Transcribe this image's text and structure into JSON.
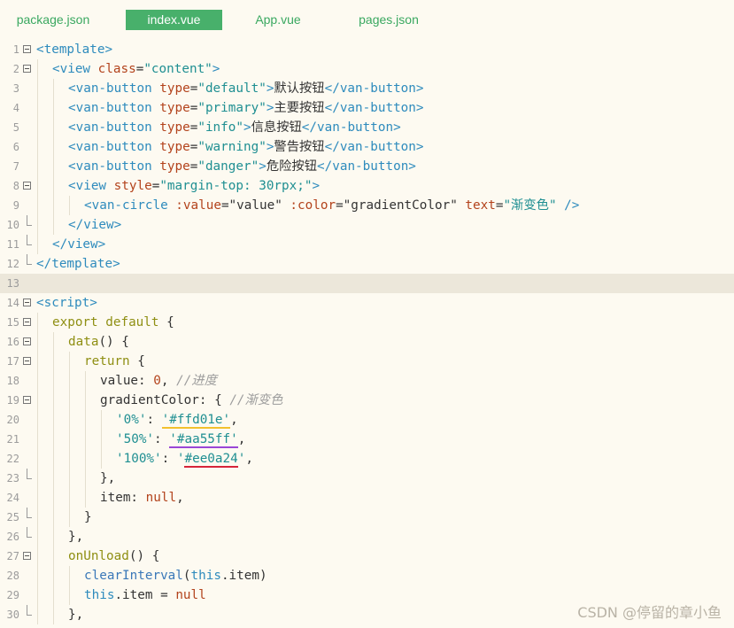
{
  "tabs": [
    {
      "label": "package.json",
      "active": false
    },
    {
      "label": "index.vue",
      "active": true
    },
    {
      "label": "App.vue",
      "active": false
    },
    {
      "label": "pages.json",
      "active": false
    }
  ],
  "lines": [
    {
      "n": "1",
      "fold": "open",
      "indent": 0,
      "tokens": [
        [
          "t-tag",
          "<template>"
        ]
      ]
    },
    {
      "n": "2",
      "fold": "open",
      "indent": 1,
      "tokens": [
        [
          "t-tag",
          "<view "
        ],
        [
          "t-attr",
          "class"
        ],
        [
          "t-txt",
          "="
        ],
        [
          "t-str",
          "\"content\""
        ],
        [
          "t-tag",
          ">"
        ]
      ]
    },
    {
      "n": "3",
      "fold": "",
      "indent": 2,
      "tokens": [
        [
          "t-tag",
          "<van-button "
        ],
        [
          "t-attr",
          "type"
        ],
        [
          "t-txt",
          "="
        ],
        [
          "t-str",
          "\"default\""
        ],
        [
          "t-tag",
          ">"
        ],
        [
          "t-txt",
          "默认按钮"
        ],
        [
          "t-tag",
          "</van-button>"
        ]
      ]
    },
    {
      "n": "4",
      "fold": "",
      "indent": 2,
      "tokens": [
        [
          "t-tag",
          "<van-button "
        ],
        [
          "t-attr",
          "type"
        ],
        [
          "t-txt",
          "="
        ],
        [
          "t-str",
          "\"primary\""
        ],
        [
          "t-tag",
          ">"
        ],
        [
          "t-txt",
          "主要按钮"
        ],
        [
          "t-tag",
          "</van-button>"
        ]
      ]
    },
    {
      "n": "5",
      "fold": "",
      "indent": 2,
      "tokens": [
        [
          "t-tag",
          "<van-button "
        ],
        [
          "t-attr",
          "type"
        ],
        [
          "t-txt",
          "="
        ],
        [
          "t-str",
          "\"info\""
        ],
        [
          "t-tag",
          ">"
        ],
        [
          "t-txt",
          "信息按钮"
        ],
        [
          "t-tag",
          "</van-button>"
        ]
      ]
    },
    {
      "n": "6",
      "fold": "",
      "indent": 2,
      "tokens": [
        [
          "t-tag",
          "<van-button "
        ],
        [
          "t-attr",
          "type"
        ],
        [
          "t-txt",
          "="
        ],
        [
          "t-str",
          "\"warning\""
        ],
        [
          "t-tag",
          ">"
        ],
        [
          "t-txt",
          "警告按钮"
        ],
        [
          "t-tag",
          "</van-button>"
        ]
      ]
    },
    {
      "n": "7",
      "fold": "",
      "indent": 2,
      "tokens": [
        [
          "t-tag",
          "<van-button "
        ],
        [
          "t-attr",
          "type"
        ],
        [
          "t-txt",
          "="
        ],
        [
          "t-str",
          "\"danger\""
        ],
        [
          "t-tag",
          ">"
        ],
        [
          "t-txt",
          "危险按钮"
        ],
        [
          "t-tag",
          "</van-button>"
        ]
      ]
    },
    {
      "n": "8",
      "fold": "open",
      "indent": 2,
      "tokens": [
        [
          "t-tag",
          "<view "
        ],
        [
          "t-attr",
          "style"
        ],
        [
          "t-txt",
          "="
        ],
        [
          "t-str",
          "\"margin-top: 30rpx;\""
        ],
        [
          "t-tag",
          ">"
        ]
      ]
    },
    {
      "n": "9",
      "fold": "",
      "indent": 3,
      "tokens": [
        [
          "t-tag",
          "<van-circle "
        ],
        [
          "t-attr",
          ":value"
        ],
        [
          "t-txt",
          "=\"value\" "
        ],
        [
          "t-attr",
          ":color"
        ],
        [
          "t-txt",
          "=\"gradientColor\" "
        ],
        [
          "t-attr",
          "text"
        ],
        [
          "t-txt",
          "="
        ],
        [
          "t-str",
          "\"渐变色\""
        ],
        [
          "t-tag",
          " />"
        ]
      ]
    },
    {
      "n": "10",
      "fold": "end",
      "indent": 2,
      "tokens": [
        [
          "t-tag",
          "</view>"
        ]
      ]
    },
    {
      "n": "11",
      "fold": "end",
      "indent": 1,
      "tokens": [
        [
          "t-tag",
          "</view>"
        ]
      ]
    },
    {
      "n": "12",
      "fold": "end",
      "indent": 0,
      "tokens": [
        [
          "t-tag",
          "</template>"
        ]
      ]
    },
    {
      "n": "13",
      "fold": "",
      "indent": 0,
      "highlight": true,
      "tokens": []
    },
    {
      "n": "14",
      "fold": "open",
      "indent": 0,
      "tokens": [
        [
          "t-tag",
          "<script>"
        ]
      ]
    },
    {
      "n": "15",
      "fold": "open",
      "indent": 1,
      "tokens": [
        [
          "t-kw",
          "export default "
        ],
        [
          "t-txt",
          "{"
        ]
      ]
    },
    {
      "n": "16",
      "fold": "open",
      "indent": 2,
      "tokens": [
        [
          "t-kw",
          "data"
        ],
        [
          "t-txt",
          "() {"
        ]
      ]
    },
    {
      "n": "17",
      "fold": "open",
      "indent": 3,
      "tokens": [
        [
          "t-kw",
          "return "
        ],
        [
          "t-txt",
          "{"
        ]
      ]
    },
    {
      "n": "18",
      "fold": "",
      "indent": 4,
      "tokens": [
        [
          "t-txt",
          "value: "
        ],
        [
          "t-num",
          "0"
        ],
        [
          "t-txt",
          ", "
        ],
        [
          "t-com",
          "//进度"
        ]
      ]
    },
    {
      "n": "19",
      "fold": "open",
      "indent": 4,
      "tokens": [
        [
          "t-txt",
          "gradientColor: { "
        ],
        [
          "t-com",
          "//渐变色"
        ]
      ]
    },
    {
      "n": "20",
      "fold": "",
      "indent": 5,
      "tokens": [
        [
          "t-str",
          "'0%'"
        ],
        [
          "t-txt",
          ": "
        ],
        [
          "t-str ul-yellow",
          "'#ffd01e'"
        ],
        [
          "t-txt",
          ","
        ]
      ]
    },
    {
      "n": "21",
      "fold": "",
      "indent": 5,
      "tokens": [
        [
          "t-str",
          "'50%'"
        ],
        [
          "t-txt",
          ": "
        ],
        [
          "t-str ul-purple",
          "'#aa55ff'"
        ],
        [
          "t-txt",
          ","
        ]
      ]
    },
    {
      "n": "22",
      "fold": "",
      "indent": 5,
      "tokens": [
        [
          "t-str",
          "'100%'"
        ],
        [
          "t-txt",
          ": "
        ],
        [
          "t-str",
          "'"
        ],
        [
          "t-str ul-red",
          "#ee0a24"
        ],
        [
          "t-str",
          "'"
        ],
        [
          "t-txt",
          ","
        ]
      ]
    },
    {
      "n": "23",
      "fold": "end",
      "indent": 4,
      "tokens": [
        [
          "t-txt",
          "},"
        ]
      ]
    },
    {
      "n": "24",
      "fold": "",
      "indent": 4,
      "tokens": [
        [
          "t-txt",
          "item: "
        ],
        [
          "t-null",
          "null"
        ],
        [
          "t-txt",
          ","
        ]
      ]
    },
    {
      "n": "25",
      "fold": "end",
      "indent": 3,
      "tokens": [
        [
          "t-txt",
          "}"
        ]
      ]
    },
    {
      "n": "26",
      "fold": "end",
      "indent": 2,
      "tokens": [
        [
          "t-txt",
          "},"
        ]
      ]
    },
    {
      "n": "27",
      "fold": "open",
      "indent": 2,
      "tokens": [
        [
          "t-kw",
          "onUnload"
        ],
        [
          "t-txt",
          "() {"
        ]
      ]
    },
    {
      "n": "28",
      "fold": "",
      "indent": 3,
      "tokens": [
        [
          "t-fn",
          "clearInterval"
        ],
        [
          "t-txt",
          "("
        ],
        [
          "t-this",
          "this"
        ],
        [
          "t-txt",
          ".item)"
        ]
      ]
    },
    {
      "n": "29",
      "fold": "",
      "indent": 3,
      "tokens": [
        [
          "t-this",
          "this"
        ],
        [
          "t-txt",
          ".item = "
        ],
        [
          "t-null",
          "null"
        ]
      ]
    },
    {
      "n": "30",
      "fold": "end",
      "indent": 2,
      "tokens": [
        [
          "t-txt",
          "},"
        ]
      ]
    }
  ],
  "watermark": "CSDN @停留的章小鱼"
}
